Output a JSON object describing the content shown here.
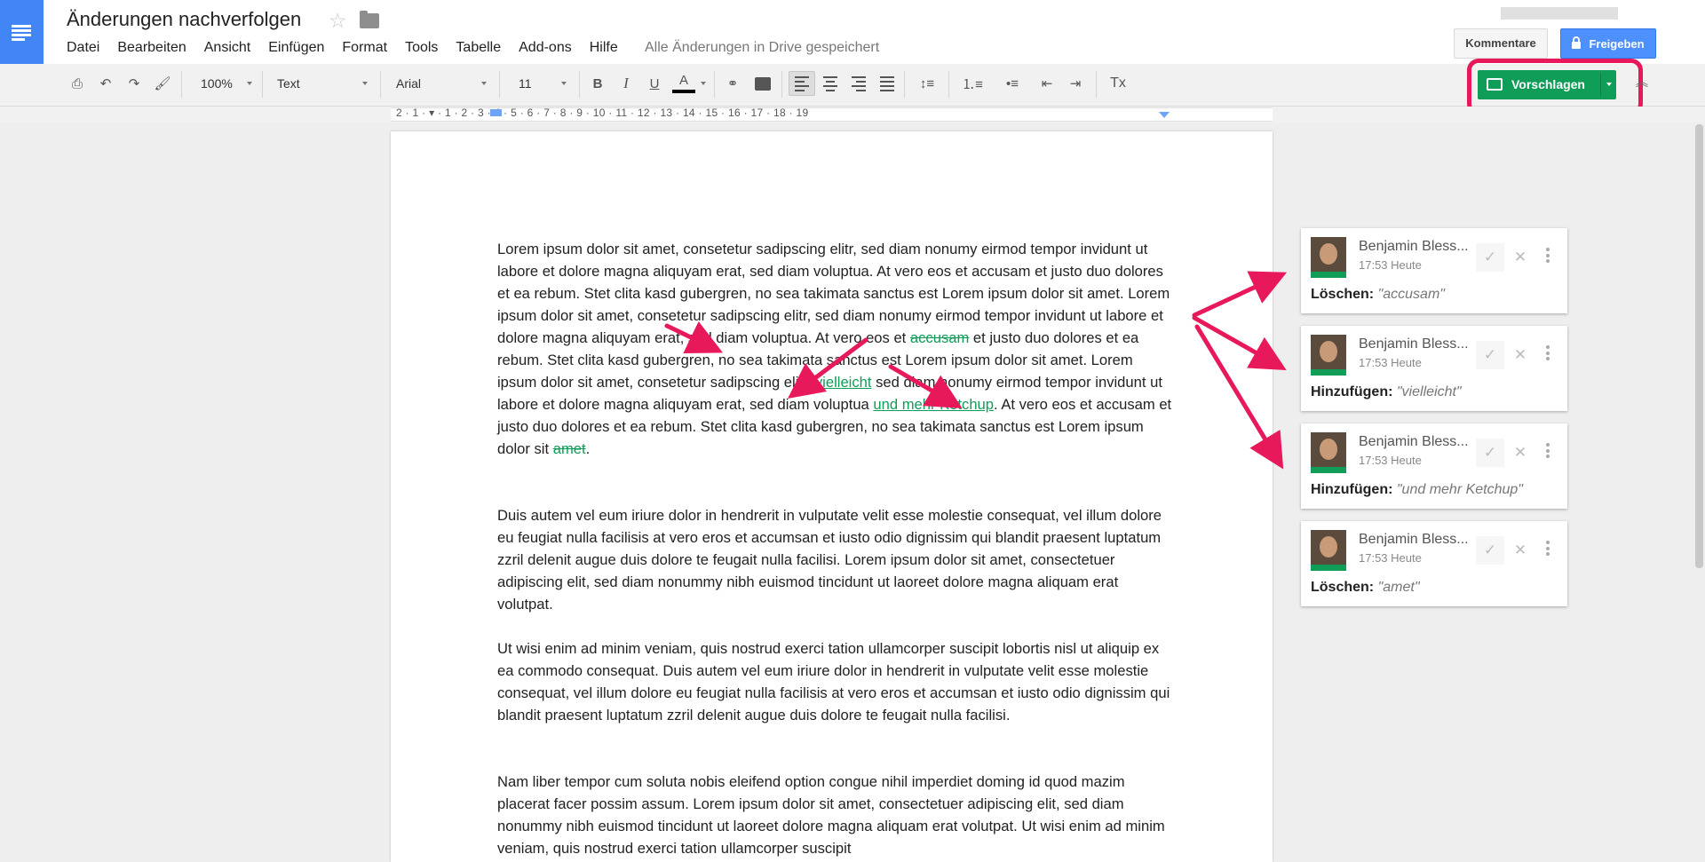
{
  "app": {
    "title": "Änderungen nachverfolgen",
    "save_status": "Alle Änderungen in Drive gespeichert"
  },
  "menu": [
    "Datei",
    "Bearbeiten",
    "Ansicht",
    "Einfügen",
    "Format",
    "Tools",
    "Tabelle",
    "Add-ons",
    "Hilfe"
  ],
  "header": {
    "comments_label": "Kommentare",
    "share_label": "Freigeben"
  },
  "toolbar": {
    "zoom": "100%",
    "style": "Text",
    "font": "Arial",
    "size": "11",
    "bold": "B",
    "italic": "I",
    "underline": "U",
    "text_color": "A",
    "clear_format": "Tx",
    "mode_label": "Vorschlagen"
  },
  "ruler": {
    "numbers": "2 · 1 · ▾ · 1 · 2 · 3 · 4 · 5 · 6 · 7 · 8 · 9 · 10 · 11 · 12 · 13 · 14 · 15 · 16 · 17 · 18 · 19"
  },
  "document": {
    "p1_a": "Lorem ipsum dolor sit amet, consetetur sadipscing elitr, sed diam nonumy eirmod tempor invidunt ut labore et dolore magna aliquyam erat, sed diam voluptua. At vero eos et accusam et justo duo dolores et ea rebum. Stet clita kasd gubergren, no sea takimata sanctus est Lorem ipsum dolor sit amet. Lorem ipsum dolor sit amet, consetetur sadipscing elitr, sed diam nonumy eirmod tempor invidunt ut labore et dolore magna aliquyam erat, sed diam voluptua. At vero eos et ",
    "p1_del1": "accusam",
    "p1_b": " et justo duo dolores et ea rebum. Stet clita kasd gubergren, no sea takimata sanctus est Lorem ipsum dolor sit amet. Lorem ipsum dolor sit amet, consetetur sadipscing elitr, ",
    "p1_ins1": "vielleicht",
    "p1_c": " sed diam nonumy eirmod tempor invidunt ut labore et dolore magna aliquyam erat, sed diam voluptua ",
    "p1_ins2": "und mehr Ketchup",
    "p1_d": ". At vero eos et accusam et justo duo dolores et ea rebum. Stet clita kasd gubergren, no sea takimata sanctus est Lorem ipsum dolor sit ",
    "p1_del2": "amet",
    "p1_e": ".",
    "p2": "Duis autem vel eum iriure dolor in hendrerit in vulputate velit esse molestie consequat, vel illum dolore eu feugiat nulla facilisis at vero eros et accumsan et iusto odio dignissim qui blandit praesent luptatum zzril delenit augue duis dolore te feugait nulla facilisi. Lorem ipsum dolor sit amet, consectetuer adipiscing elit, sed diam nonummy nibh euismod tincidunt ut laoreet dolore magna aliquam erat volutpat.",
    "p3": "Ut wisi enim ad minim veniam, quis nostrud exerci tation ullamcorper suscipit lobortis nisl ut aliquip ex ea commodo consequat. Duis autem vel eum iriure dolor in hendrerit in vulputate velit esse molestie consequat, vel illum dolore eu feugiat nulla facilisis at vero eros et accumsan et iusto odio dignissim qui blandit praesent luptatum zzril delenit augue duis dolore te feugait nulla facilisi.",
    "p4": "Nam liber tempor cum soluta nobis eleifend option congue nihil imperdiet doming id quod mazim placerat facer possim assum. Lorem ipsum dolor sit amet, consectetuer adipiscing elit, sed diam nonummy nibh euismod tincidunt ut laoreet dolore magna aliquam erat volutpat. Ut wisi enim ad minim veniam, quis nostrud exerci tation ullamcorper suscipit"
  },
  "suggestions": [
    {
      "author": "Benjamin Bless...",
      "time": "17:53 Heute",
      "action": "Löschen:",
      "text": "\"accusam\""
    },
    {
      "author": "Benjamin Bless...",
      "time": "17:53 Heute",
      "action": "Hinzufügen:",
      "text": "\"vielleicht\""
    },
    {
      "author": "Benjamin Bless...",
      "time": "17:53 Heute",
      "action": "Hinzufügen:",
      "text": "\"und mehr Ketchup\""
    },
    {
      "author": "Benjamin Bless...",
      "time": "17:53 Heute",
      "action": "Löschen:",
      "text": "\"amet\""
    }
  ],
  "colors": {
    "accent": "#4285f4",
    "suggest_green": "#0f9d58",
    "annotation": "#e8195a",
    "share_blue": "#4d90fe"
  }
}
